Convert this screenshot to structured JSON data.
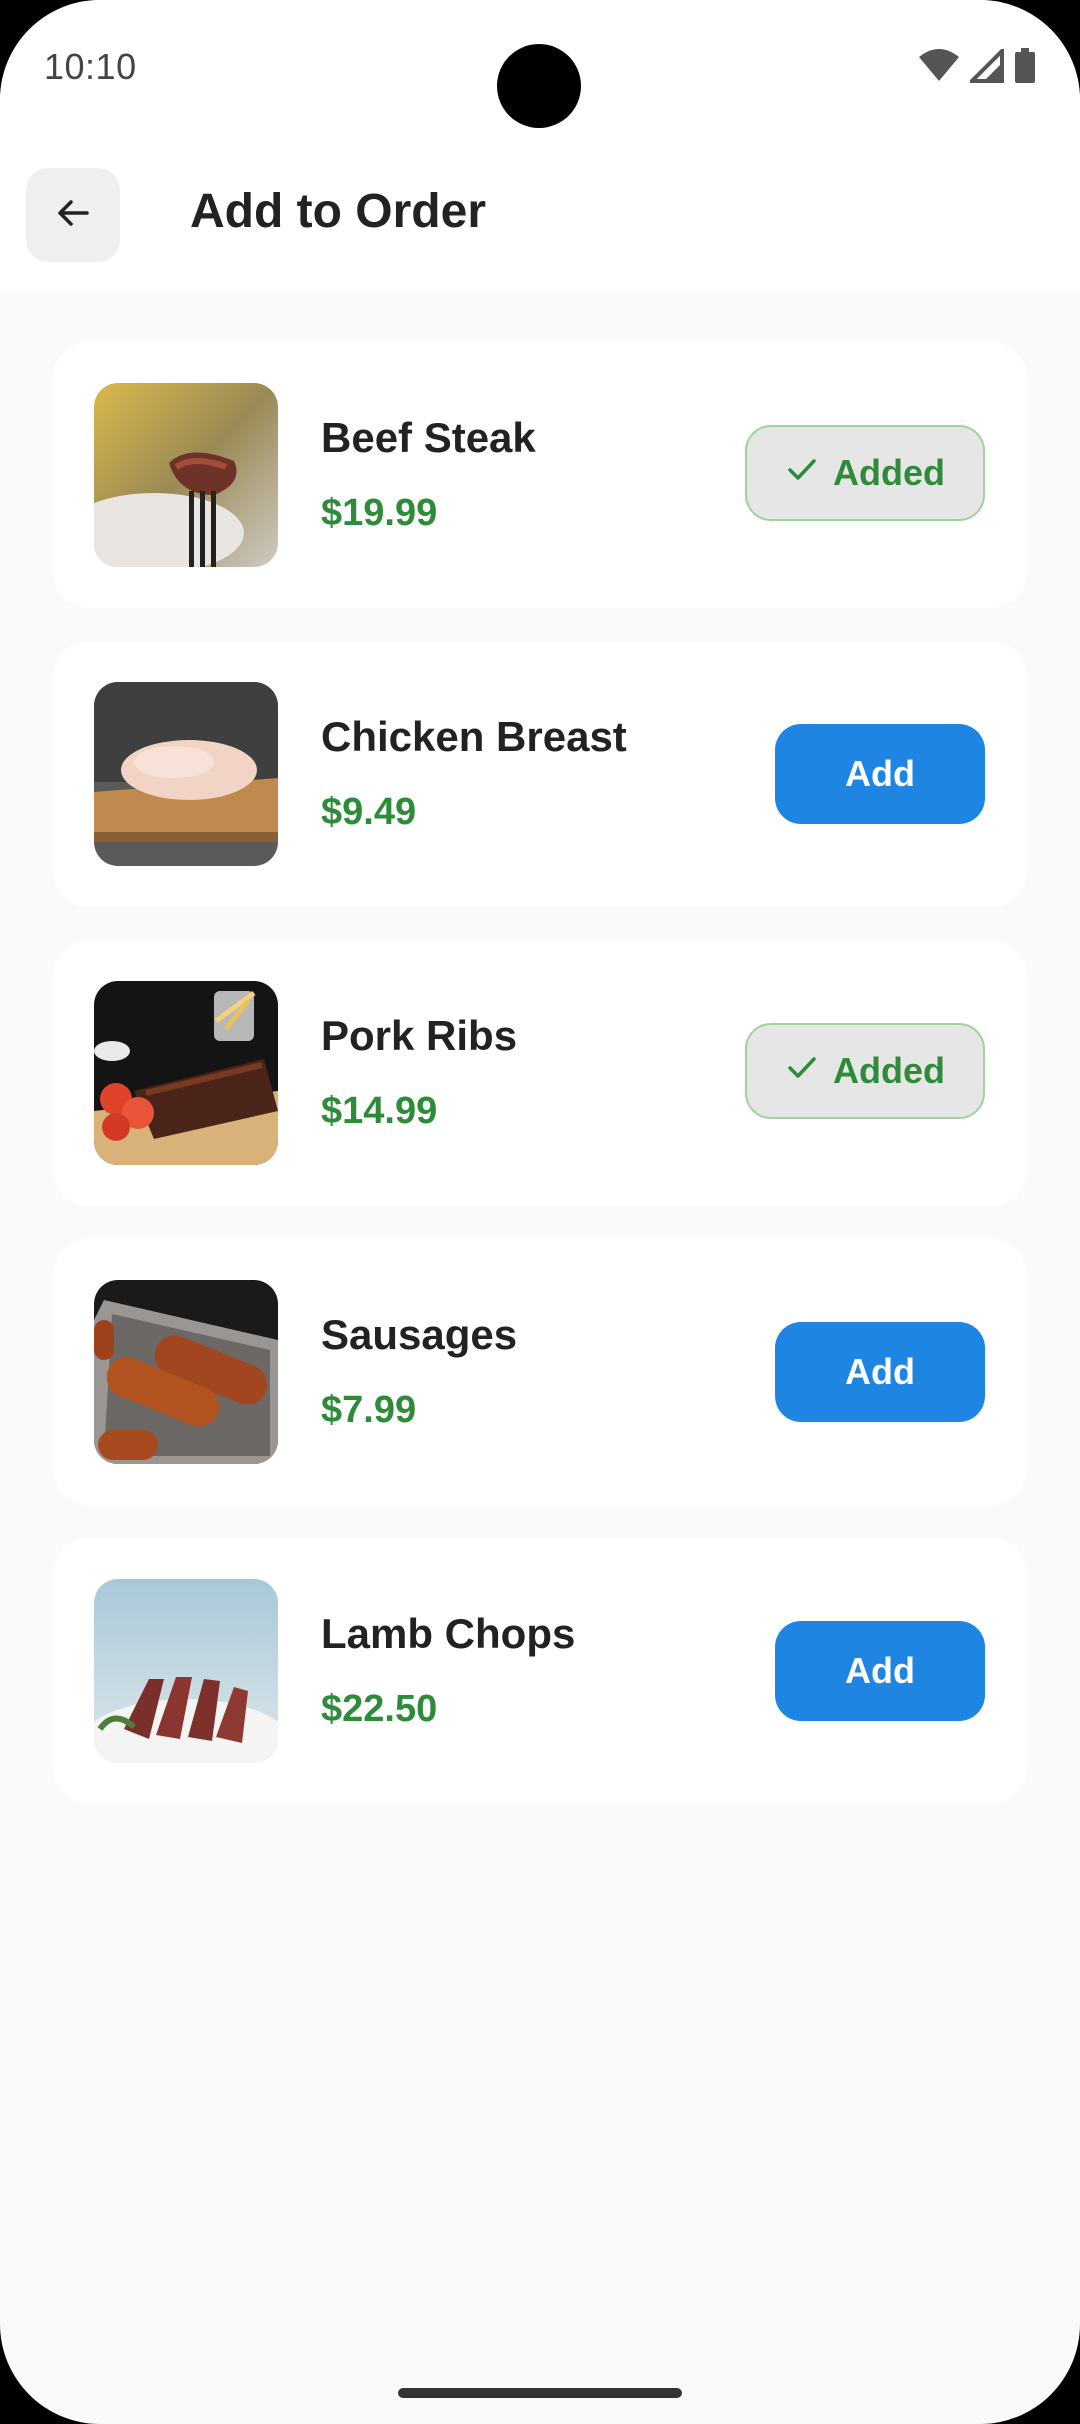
{
  "status_bar": {
    "time": "10:10",
    "icons": [
      "wifi-icon",
      "signal-icon",
      "battery-icon"
    ]
  },
  "app_bar": {
    "title": "Add to Order",
    "back_icon": "arrow-left-icon"
  },
  "items": [
    {
      "name": "Beef Steak",
      "price": "$19.99",
      "state": "added",
      "button_label": "Added"
    },
    {
      "name": "Chicken Breast",
      "price": "$9.49",
      "state": "add",
      "button_label": "Add"
    },
    {
      "name": "Pork Ribs",
      "price": "$14.99",
      "state": "added",
      "button_label": "Added"
    },
    {
      "name": "Sausages",
      "price": "$7.99",
      "state": "add",
      "button_label": "Add"
    },
    {
      "name": "Lamb Chops",
      "price": "$22.50",
      "state": "add",
      "button_label": "Add"
    }
  ],
  "colors": {
    "accent": "#1e86e2",
    "price_green": "#2e8b3a",
    "added_bg": "#e6e6e6",
    "added_border": "#9ed39c"
  }
}
